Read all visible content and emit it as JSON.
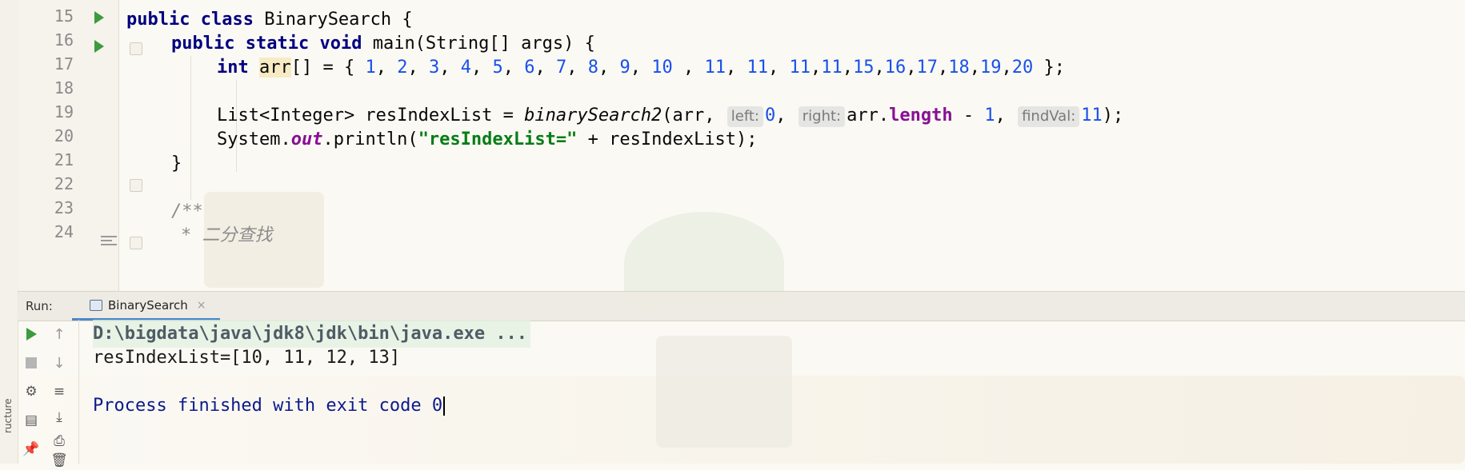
{
  "editor": {
    "lines": [
      {
        "num": "15",
        "tokens": [
          "public",
          "class",
          "BinarySearch {"
        ]
      },
      {
        "num": "16",
        "tokens": [
          "public",
          "static",
          "void",
          "main(String[] args) {"
        ]
      },
      {
        "num": "17",
        "tokens": [
          "int",
          "arr",
          "[] = { ",
          "1",
          ", ",
          "2",
          ", ",
          "3",
          ", ",
          "4",
          ", ",
          "5",
          ", ",
          "6",
          ", ",
          "7",
          ", ",
          "8",
          ", ",
          "9",
          ", ",
          "10",
          " , ",
          "11",
          ", ",
          "11",
          ", ",
          "11",
          ",",
          "11",
          ",",
          "15",
          ",",
          "16",
          ",",
          "17",
          ",",
          "18",
          ",",
          "19",
          ",",
          "20",
          " };"
        ]
      },
      {
        "num": "18",
        "tokens": []
      },
      {
        "num": "19",
        "tokens": [
          "List<Integer> resIndexList = ",
          "binarySearch2",
          "(arr, ",
          "left:",
          "0",
          ", ",
          "right:",
          "arr.",
          "length",
          " - ",
          "1",
          ", ",
          "findVal:",
          "11",
          ");"
        ]
      },
      {
        "num": "20",
        "tokens": [
          "System.",
          "out",
          ".println(",
          "\"resIndexList=\"",
          " + resIndexList);"
        ]
      },
      {
        "num": "21",
        "tokens": [
          "}"
        ]
      },
      {
        "num": "22",
        "tokens": []
      },
      {
        "num": "23",
        "tokens": [
          "/**"
        ]
      },
      {
        "num": "24",
        "tokens": [
          "* 二分查找"
        ]
      }
    ]
  },
  "run_panel": {
    "title": "Run:",
    "tab_label": "BinarySearch",
    "tab_close": "×"
  },
  "console": {
    "cmd": "D:\\bigdata\\java\\jdk8\\jdk\\bin\\java.exe ...",
    "output": "resIndexList=[10, 11, 12, 13]",
    "exit": "Process finished with exit code 0"
  },
  "side_strip": {
    "label": "ructure"
  },
  "icons": {
    "toolbar": [
      "play-icon",
      "stop-icon",
      "rerun-failed-icon",
      "layout-icon",
      "pin-icon",
      "arrow-up-icon",
      "arrow-down-icon",
      "soft-wrap-icon",
      "scroll-to-end-icon",
      "print-icon",
      "trash-icon"
    ]
  },
  "colors": {
    "keyword": "#0033b3",
    "number": "#1750eb",
    "string": "#067d17",
    "field": "#871094",
    "comment": "#8c8c8c",
    "run_green": "#3c9b3c",
    "tab_underline": "#4a88c7"
  }
}
